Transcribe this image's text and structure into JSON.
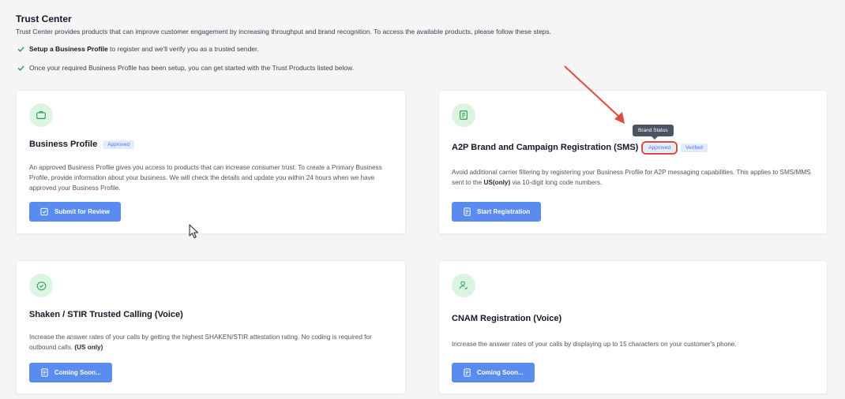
{
  "header": {
    "title": "Trust Center",
    "description": "Trust Center provides products that can improve customer engagement by increasing throughput and brand recognition. To access the available products, please follow these steps."
  },
  "steps": [
    {
      "bold": "Setup a Business Profile",
      "text": " to register and we'll verify you as a trusted sender."
    },
    {
      "bold": "",
      "text": "Once your required Business Profile has been setup, you can get started with the Trust Products listed below."
    }
  ],
  "cards": {
    "business_profile": {
      "icon": "briefcase-icon",
      "title": "Business Profile",
      "badge": "Approved",
      "description": "An approved Business Profile gives you access to products that can increase consumer trust. To create a Primary Business Profile, provide information about your business. We will check the details and update you within 24 hours when we have approved your Business Profile.",
      "button": "Submit for Review",
      "button_icon": "checkbox-edit-icon"
    },
    "a2p": {
      "icon": "document-icon",
      "title": "A2P Brand and Campaign Registration (SMS)",
      "badge_brand": "Approved",
      "badge_campaign": "Verified",
      "tooltip": "Brand Status",
      "description_1": "Avoid additional carrier filtering by registering your Business Profile for A2P messaging capabilities. This applies to SMS/MMS sent to the ",
      "description_bold": "US(only)",
      "description_2": " via 10-digit long code numbers.",
      "button": "Start Registration",
      "button_icon": "document-icon"
    },
    "shaken_stir": {
      "icon": "verified-badge-icon",
      "title": "Shaken / STIR Trusted Calling (Voice)",
      "description_1": "Increase the answer rates of your calls by getting the highest SHAKEN/STIR attestation rating. No coding is required for outbound calls. ",
      "description_bold": "(US only)",
      "button": "Coming Soon...",
      "button_icon": "document-icon"
    },
    "cnam": {
      "icon": "user-check-icon",
      "title": "CNAM Registration (Voice)",
      "description": "Increase the answer rates of your calls by displaying up to 15 characters on your customer's phone.",
      "button": "Coming Soon...",
      "button_icon": "document-icon"
    }
  },
  "colors": {
    "accent": "#5a8cf0",
    "icon_bg": "#dcf5e3",
    "icon_fg": "#2f9e5a",
    "badge_bg": "#e3ecff",
    "badge_fg": "#4a77e8",
    "annotation": "#e04a3c"
  }
}
